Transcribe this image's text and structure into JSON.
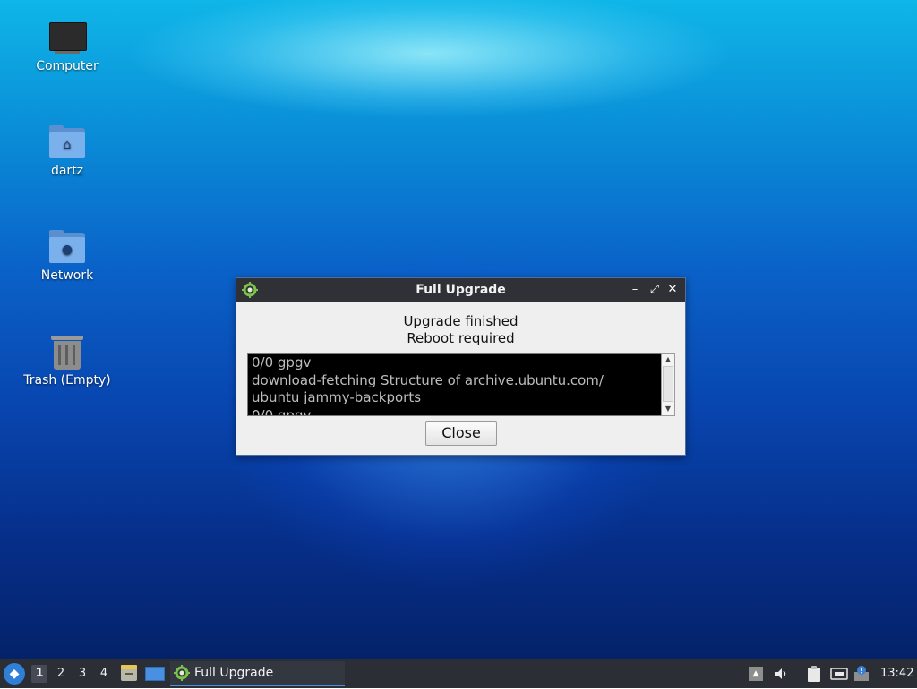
{
  "desktop": {
    "icons": [
      {
        "label": "Computer",
        "icon": "computer-icon"
      },
      {
        "label": "dartz",
        "icon": "home-folder-icon"
      },
      {
        "label": "Network",
        "icon": "network-folder-icon"
      },
      {
        "label": "Trash (Empty)",
        "icon": "trash-icon"
      }
    ]
  },
  "dialog": {
    "title": "Full Upgrade",
    "message_line1": "Upgrade finished",
    "message_line2": "Reboot required",
    "log_text": "0/0 gpgv\ndownload-fetching Structure of archive.ubuntu.com/\nubuntu jammy-backports\n0/0 gpgv",
    "close_label": "Close",
    "window_buttons": {
      "minimize": "–",
      "maximize": "⤢",
      "close": "✕"
    }
  },
  "taskbar": {
    "workspaces": [
      "1",
      "2",
      "3",
      "4"
    ],
    "active_workspace": "1",
    "task_label": "Full Upgrade",
    "clock": "13:42",
    "accent": "#4f8fe0"
  }
}
